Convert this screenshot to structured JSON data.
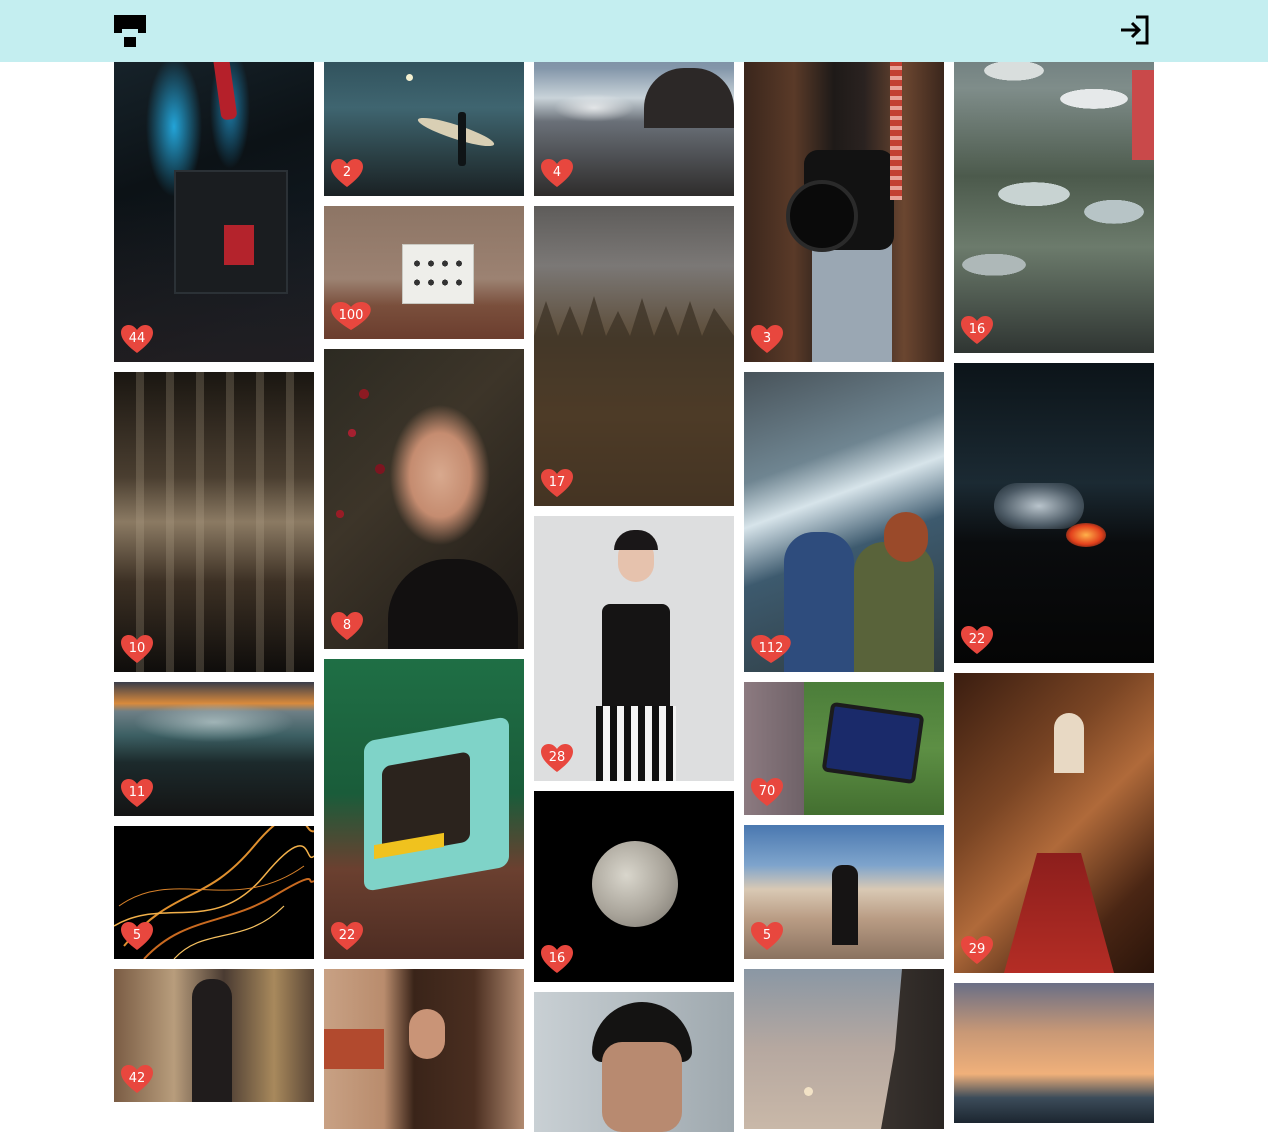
{
  "header": {
    "logo_icon": "brand-logo-icon",
    "login_icon": "sign-in-icon",
    "background": "#c4eef0"
  },
  "heart_color": "#e8473e",
  "columns": [
    {
      "tiles": [
        {
          "name": "pc-build-photo",
          "likes": "44"
        },
        {
          "name": "abstract-architecture-photo",
          "likes": "10"
        },
        {
          "name": "coastal-iguana-photo",
          "likes": "11"
        },
        {
          "name": "light-trails-photo",
          "likes": "5"
        },
        {
          "name": "street-photographer-photo",
          "likes": "42"
        }
      ]
    },
    {
      "tiles": [
        {
          "name": "surfer-moonlight-photo",
          "likes": "2"
        },
        {
          "name": "wall-outlets-photo",
          "likes": "100"
        },
        {
          "name": "woman-portrait-berries-photo",
          "likes": "8"
        },
        {
          "name": "retro-tv-photo",
          "likes": "22"
        },
        {
          "name": "curly-hair-portrait-photo",
          "likes": ""
        }
      ]
    },
    {
      "tiles": [
        {
          "name": "rocky-shore-waves-photo",
          "likes": "4"
        },
        {
          "name": "misty-forest-photo",
          "likes": "17"
        },
        {
          "name": "woman-glasses-portrait-photo",
          "likes": "28"
        },
        {
          "name": "full-moon-photo",
          "likes": "16"
        },
        {
          "name": "man-portrait-photo",
          "likes": ""
        }
      ]
    },
    {
      "tiles": [
        {
          "name": "camera-holder-photo",
          "likes": "3"
        },
        {
          "name": "couple-cliff-coast-photo",
          "likes": "112"
        },
        {
          "name": "tablet-drawing-photo",
          "likes": "70"
        },
        {
          "name": "couple-rocks-photo",
          "likes": "5"
        },
        {
          "name": "moon-cliff-sunset-photo",
          "likes": ""
        }
      ]
    },
    {
      "tiles": [
        {
          "name": "boats-low-tide-photo",
          "likes": "16"
        },
        {
          "name": "volcano-night-photo",
          "likes": "22"
        },
        {
          "name": "spiral-staircase-photo",
          "likes": "29"
        },
        {
          "name": "ocean-sunset-photo",
          "likes": ""
        }
      ]
    }
  ]
}
